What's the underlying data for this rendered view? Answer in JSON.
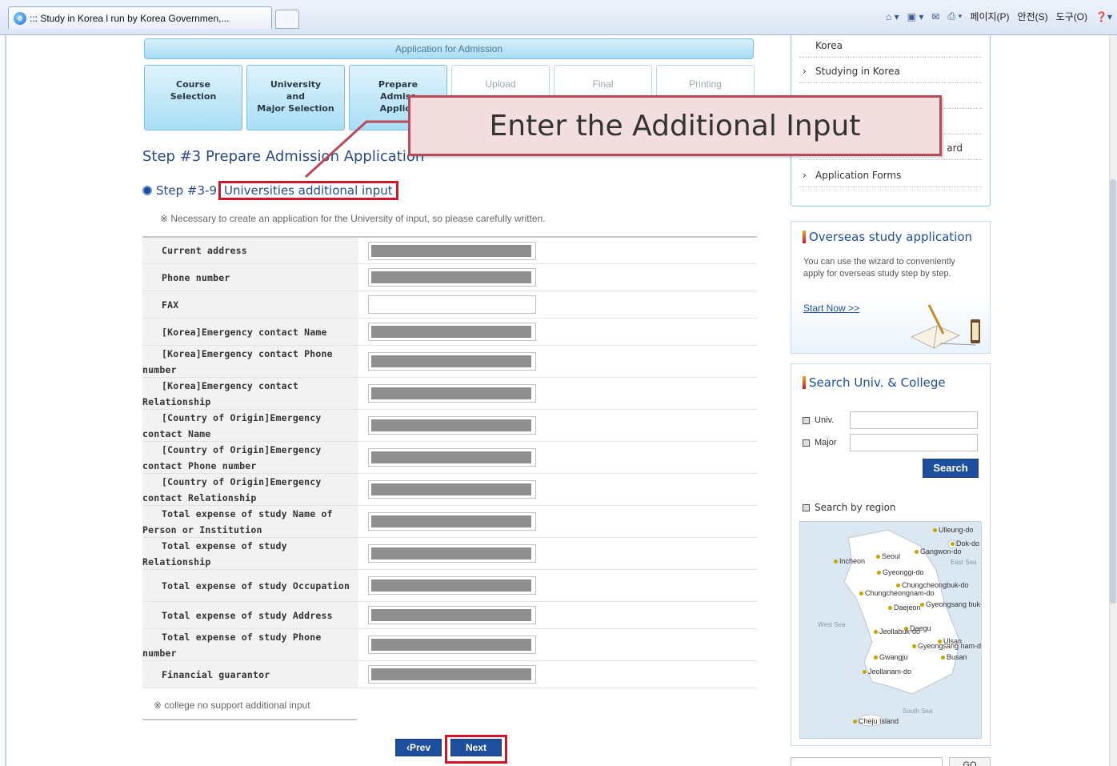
{
  "browser": {
    "tab_title": "::: Study in Korea l run by Korea Governmen,...",
    "commands": [
      "페이지(P)",
      "안전(S)",
      "도구(O)"
    ]
  },
  "header": {
    "application_bar": "Application for Admission"
  },
  "steps": [
    {
      "lines": [
        "Course",
        "Selection"
      ],
      "state": "done"
    },
    {
      "lines": [
        "University",
        "and",
        "Major Selection"
      ],
      "state": "done"
    },
    {
      "lines": [
        "Prepare",
        "Admiss",
        "Applica"
      ],
      "state": "done"
    },
    {
      "lines": [
        "Upload"
      ],
      "state": "todo"
    },
    {
      "lines": [
        "Final"
      ],
      "state": "todo"
    },
    {
      "lines": [
        "Printing"
      ],
      "state": "todo"
    }
  ],
  "callout": {
    "text": "Enter the Additional Input",
    "border_color": "#b94a5a",
    "fill_color": "#f2dede"
  },
  "main": {
    "step_title": "Step #3 Prepare Admission Application",
    "sub_prefix": "Step #3-9",
    "sub_title": "Universities additional input",
    "note": "※ Necessary to create an application for the University of input, so please carefully written.",
    "foot_note": "※ college no support additional input"
  },
  "form": {
    "rows": [
      {
        "label": "Current address",
        "filled": true
      },
      {
        "label": "Phone number",
        "filled": true
      },
      {
        "label": "FAX",
        "filled": false
      },
      {
        "label": "[Korea]Emergency contact Name",
        "filled": true
      },
      {
        "label": "[Korea]Emergency contact Phone number",
        "filled": true
      },
      {
        "label": "[Korea]Emergency contact Relationship",
        "filled": true
      },
      {
        "label": "[Country of Origin]Emergency contact Name",
        "filled": true
      },
      {
        "label": "[Country of Origin]Emergency contact Phone number",
        "filled": true
      },
      {
        "label": "[Country of Origin]Emergency contact Relationship",
        "filled": true
      },
      {
        "label": "Total expense of study Name of Person or Institution",
        "filled": true
      },
      {
        "label": "Total expense of study Relationship",
        "filled": true
      },
      {
        "label": "Total expense of study Occupation",
        "filled": true
      },
      {
        "label": "Total expense of study Address",
        "filled": true
      },
      {
        "label": "Total expense of study Phone number",
        "filled": true
      },
      {
        "label": "Financial guarantor",
        "filled": true
      }
    ]
  },
  "buttons": {
    "prev": "‹Prev",
    "next": "Next",
    "highlight_color": "#d0162b"
  },
  "sidebar": {
    "menu": [
      {
        "label": "Korea",
        "arrow": false
      },
      {
        "label": "Studying in Korea",
        "arrow": true
      },
      {
        "label": "",
        "arrow": true
      },
      {
        "label": "",
        "arrow": true
      },
      {
        "label": "ard",
        "arrow": true
      },
      {
        "label": "Application Forms",
        "arrow": true
      }
    ],
    "overseas": {
      "title": "Overseas study application",
      "text": "You can use the wizard to conveniently apply for overseas study step by step.",
      "link": "Start Now >>"
    },
    "search": {
      "title": "Search Univ. & College",
      "univ_label": "Univ.",
      "major_label": "Major",
      "button": "Search",
      "region_label": "Search by region"
    },
    "map_labels": [
      "Ulleung-do",
      "Dok-do",
      "Gangwon-do",
      "Seoul",
      "Incheon",
      "East Sea",
      "Gyeonggi-do",
      "Chungcheongbuk-do",
      "Chungcheongnam-do",
      "Gyeongsang buk-do",
      "Daejeon",
      "West Sea",
      "Daegu",
      "Jeollabuk-do",
      "Ulsan",
      "Gyeongsang nam-do",
      "Gwangju",
      "Busan",
      "Jeollanam-do",
      "South Sea",
      "Cheju Island"
    ],
    "go": "GO"
  }
}
